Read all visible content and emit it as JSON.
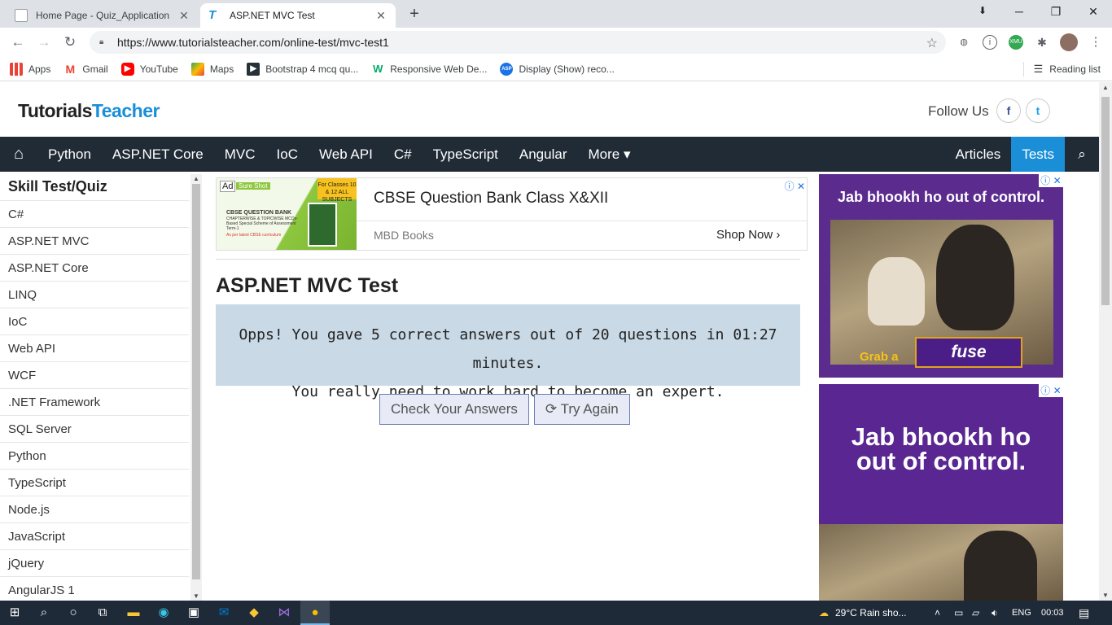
{
  "browser": {
    "tabs": [
      {
        "title": "Home Page - Quiz_Application",
        "active": false
      },
      {
        "title": "ASP.NET MVC Test",
        "active": true
      }
    ],
    "new_tab": "+",
    "window_controls": {
      "minimize": "─",
      "maximize": "❐",
      "close": "✕"
    },
    "url": "https://www.tutorialsteacher.com/online-test/mvc-test1",
    "bookmarks": [
      {
        "label": "Apps",
        "icon": "apps-grid-icon"
      },
      {
        "label": "Gmail",
        "icon": "gmail-icon"
      },
      {
        "label": "YouTube",
        "icon": "youtube-icon"
      },
      {
        "label": "Maps",
        "icon": "maps-icon"
      },
      {
        "label": "Bootstrap 4 mcq qu...",
        "icon": "bookmark-site-icon"
      },
      {
        "label": "Responsive Web De...",
        "icon": "w3-icon"
      },
      {
        "label": "Display (Show) reco...",
        "icon": "aspsnippets-icon"
      }
    ],
    "reading_list": "Reading list"
  },
  "site": {
    "logo_part1": "Tutorials",
    "logo_part2": "Teacher",
    "follow_us": "Follow Us",
    "social": {
      "facebook": "f",
      "twitter": "t"
    },
    "nav": {
      "items": [
        "Python",
        "ASP.NET Core",
        "MVC",
        "IoC",
        "Web API",
        "C#",
        "TypeScript",
        "Angular",
        "More ▾"
      ],
      "right": [
        "Articles",
        "Tests"
      ]
    }
  },
  "sidebar": {
    "title": "Skill Test/Quiz",
    "items": [
      "C#",
      "ASP.NET MVC",
      "ASP.NET Core",
      "LINQ",
      "IoC",
      "Web API",
      "WCF",
      ".NET Framework",
      "SQL Server",
      "Python",
      "TypeScript",
      "Node.js",
      "JavaScript",
      "jQuery",
      "AngularJS 1"
    ]
  },
  "ad_banner": {
    "badge": "Ad",
    "sure_shot": "Sure Shot",
    "classes": "For Classes 10 & 12 ALL SUBJECTS",
    "book_title": "CBSE QUESTION BANK",
    "book_sub": "CHAPTERWISE & TOPICWISE MCQs-Based Special Scheme of Assessment Term-1",
    "book_note": "As per latest CBSE curriculum",
    "headline": "CBSE Question Bank Class X&XII",
    "advertiser": "MBD Books",
    "cta": "Shop Now ›",
    "controls": "ⓘ ✕"
  },
  "main": {
    "heading": "ASP.NET MVC Test",
    "result_line1": "Opps! You gave 5 correct answers out of 20 questions in 01:27 minutes.",
    "result_line2": "You really need to work hard to become an expert.",
    "check_button": "Check Your Answers",
    "retry_button": "⟳ Try Again"
  },
  "side_ads": {
    "ad1_headline": "Jab bhookh ho out of control.",
    "ad1_grab": "Grab a",
    "ad1_brand": "fuse",
    "ad2_headline_line1": "Jab bhookh ho",
    "ad2_headline_line2": "out of control.",
    "controls": "ⓘ ✕"
  },
  "taskbar": {
    "weather": "29°C  Rain sho...",
    "language": "ENG",
    "time": "00:03"
  }
}
